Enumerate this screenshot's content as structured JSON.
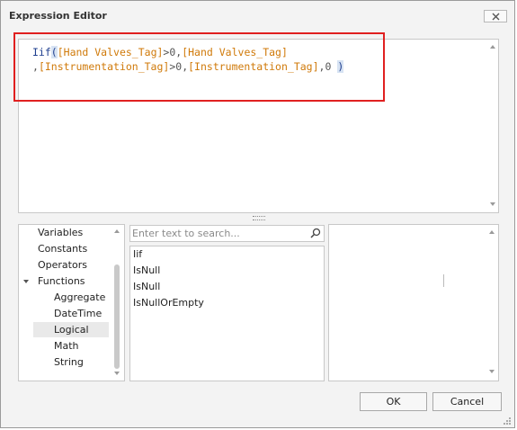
{
  "window": {
    "title": "Expression Editor",
    "close_icon": "close-icon"
  },
  "expression": {
    "fn": "Iif",
    "open_paren": "(",
    "field1": "[Hand Valves_Tag]",
    "op1": ">0,",
    "field2": "[Hand Valves_Tag]",
    "line2_start": ",",
    "field3": "[Instrumentation_Tag]",
    "op2": ">0,",
    "field4": "[Instrumentation_Tag]",
    "op3": ",0 ",
    "close_paren": ")"
  },
  "categories": {
    "items": [
      "Variables",
      "Constants",
      "Operators",
      "Functions"
    ],
    "functions_children": [
      "Aggregate",
      "DateTime",
      "Logical",
      "Math",
      "String"
    ],
    "selected": "Logical"
  },
  "search": {
    "placeholder": "Enter text to search...",
    "value": ""
  },
  "functions_list": [
    "Iif",
    "IsNull",
    "IsNull",
    "IsNullOrEmpty"
  ],
  "buttons": {
    "ok": "OK",
    "cancel": "Cancel"
  },
  "colors": {
    "highlight_border": "#e02020",
    "field_color": "#d07a0a",
    "function_color": "#1f3f8f"
  }
}
